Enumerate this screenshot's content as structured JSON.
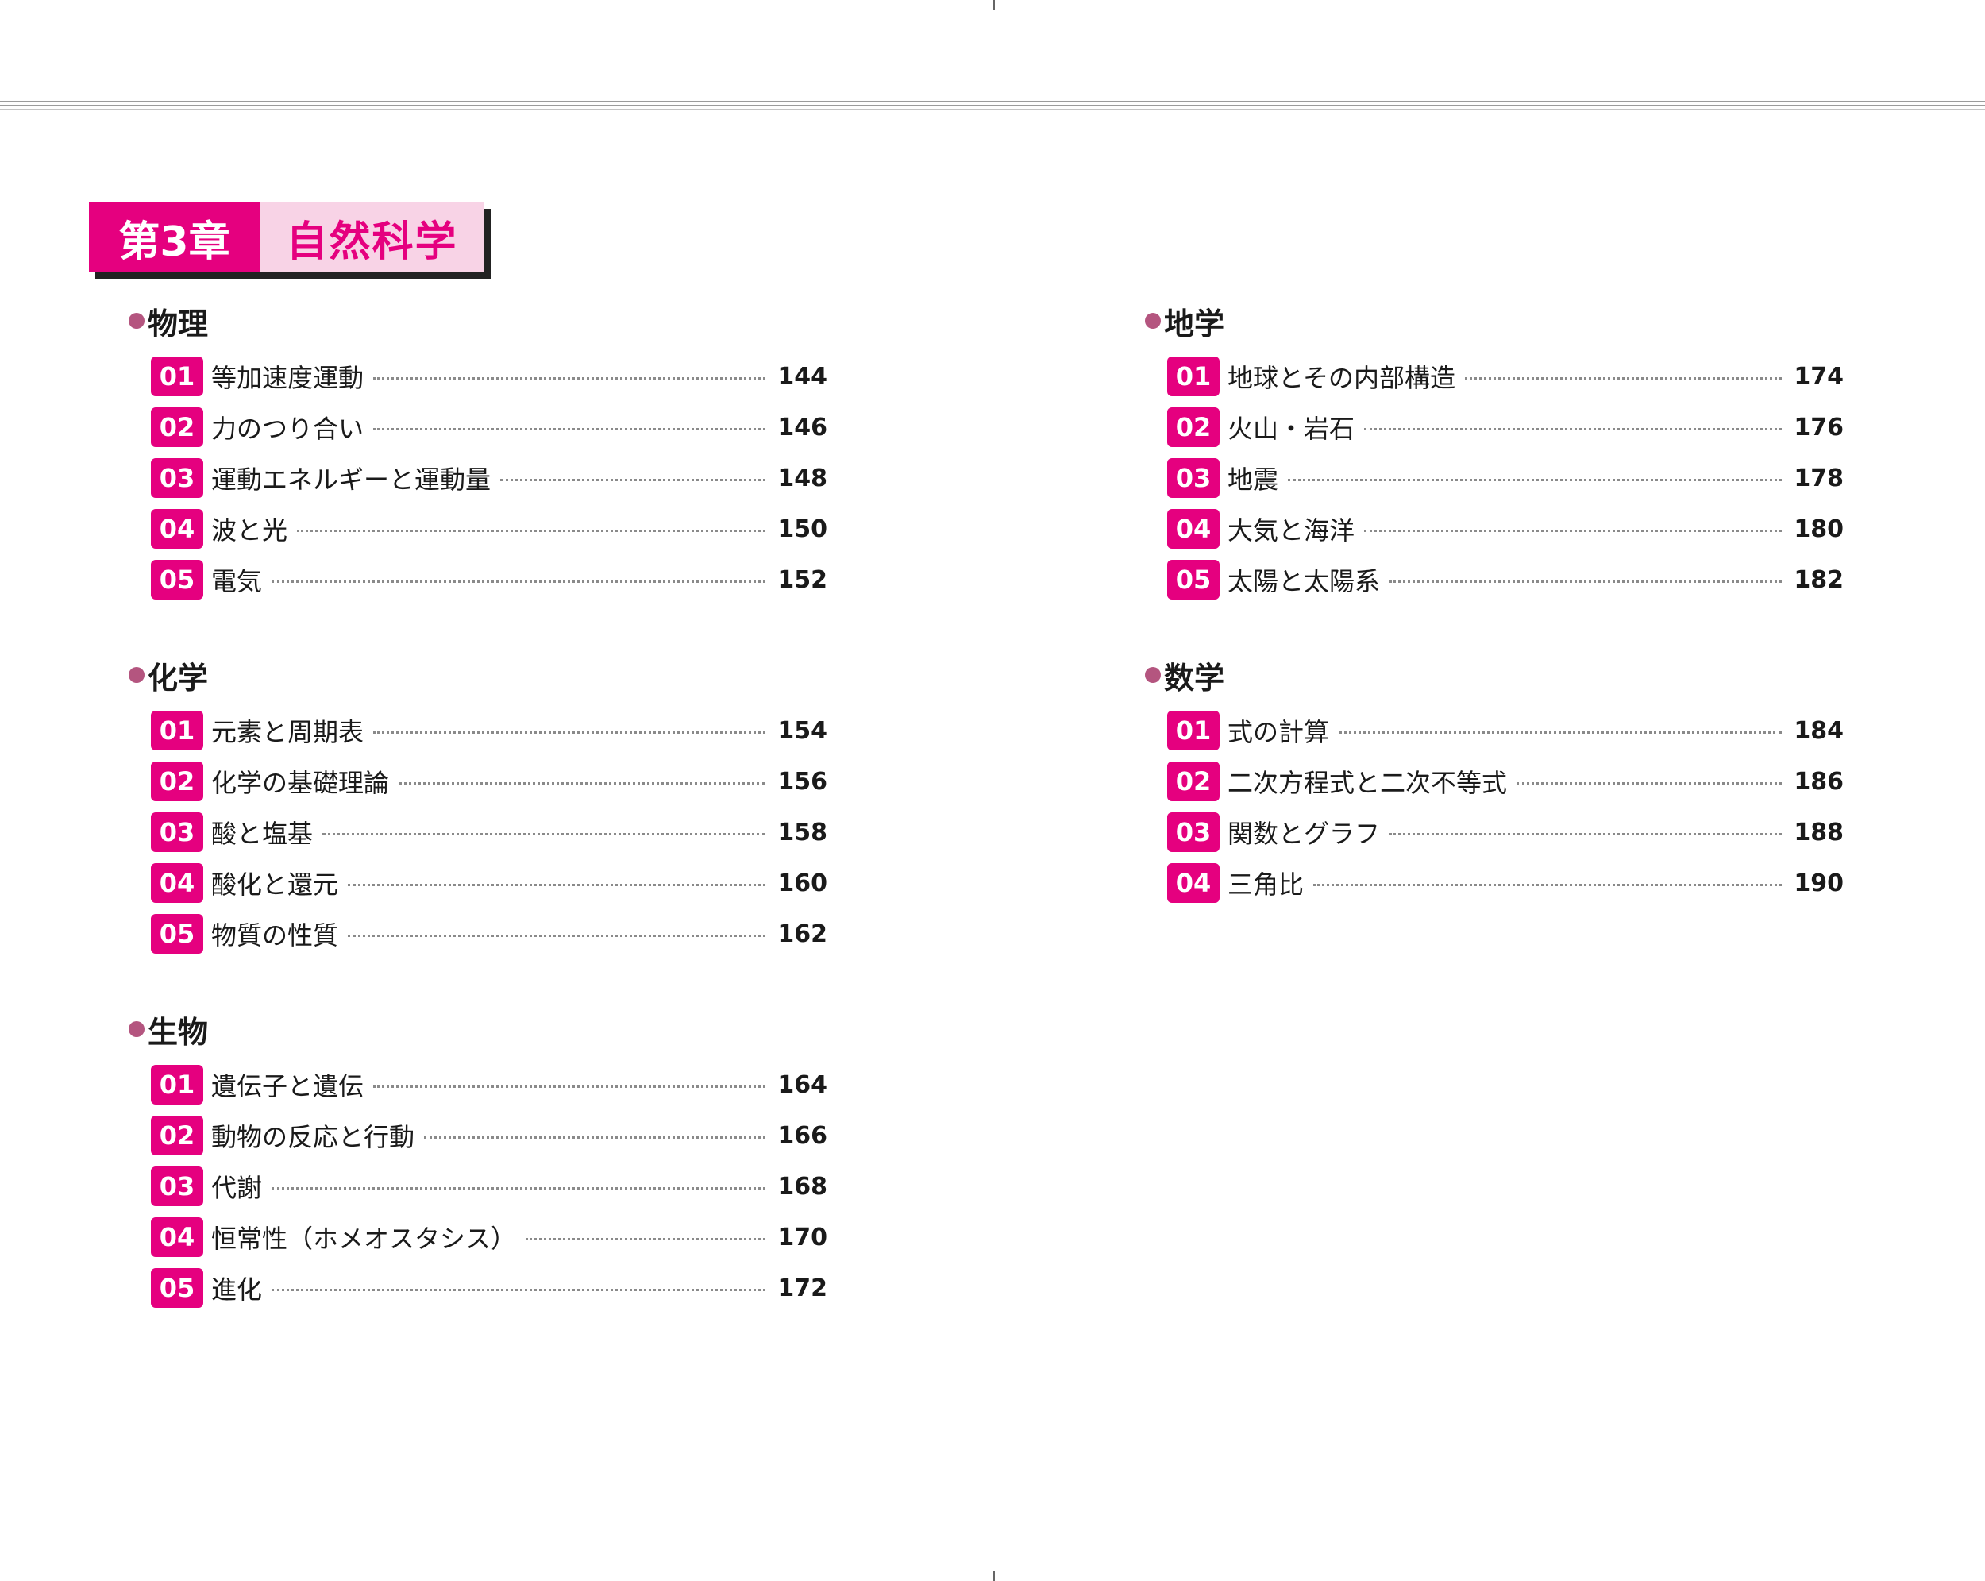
{
  "chapter": {
    "number": "第3章",
    "title": "自然科学"
  },
  "sections": [
    {
      "title": "物理",
      "items": [
        {
          "num": "01",
          "label": "等加速度運動",
          "page": "144"
        },
        {
          "num": "02",
          "label": "力のつり合い",
          "page": "146"
        },
        {
          "num": "03",
          "label": "運動エネルギーと運動量",
          "page": "148"
        },
        {
          "num": "04",
          "label": "波と光",
          "page": "150"
        },
        {
          "num": "05",
          "label": "電気",
          "page": "152"
        }
      ]
    },
    {
      "title": "化学",
      "items": [
        {
          "num": "01",
          "label": "元素と周期表",
          "page": "154"
        },
        {
          "num": "02",
          "label": "化学の基礎理論",
          "page": "156"
        },
        {
          "num": "03",
          "label": "酸と塩基",
          "page": "158"
        },
        {
          "num": "04",
          "label": "酸化と還元",
          "page": "160"
        },
        {
          "num": "05",
          "label": "物質の性質",
          "page": "162"
        }
      ]
    },
    {
      "title": "生物",
      "items": [
        {
          "num": "01",
          "label": "遺伝子と遺伝",
          "page": "164"
        },
        {
          "num": "02",
          "label": "動物の反応と行動",
          "page": "166"
        },
        {
          "num": "03",
          "label": "代謝",
          "page": "168"
        },
        {
          "num": "04",
          "label": "恒常性（ホメオスタシス）",
          "page": "170"
        },
        {
          "num": "05",
          "label": "進化",
          "page": "172"
        }
      ]
    },
    {
      "title": "地学",
      "items": [
        {
          "num": "01",
          "label": "地球とその内部構造",
          "page": "174"
        },
        {
          "num": "02",
          "label": "火山・岩石",
          "page": "176"
        },
        {
          "num": "03",
          "label": "地震",
          "page": "178"
        },
        {
          "num": "04",
          "label": "大気と海洋",
          "page": "180"
        },
        {
          "num": "05",
          "label": "太陽と太陽系",
          "page": "182"
        }
      ]
    },
    {
      "title": "数学",
      "items": [
        {
          "num": "01",
          "label": "式の計算",
          "page": "184"
        },
        {
          "num": "02",
          "label": "二次方程式と二次不等式",
          "page": "186"
        },
        {
          "num": "03",
          "label": "関数とグラフ",
          "page": "188"
        },
        {
          "num": "04",
          "label": "三角比",
          "page": "190"
        }
      ]
    }
  ]
}
